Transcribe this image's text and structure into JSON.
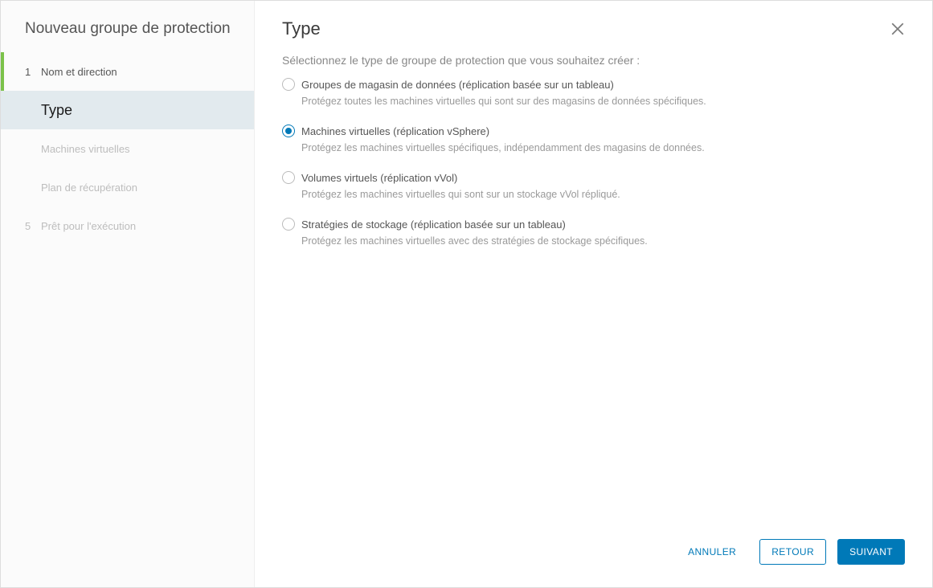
{
  "wizard": {
    "title": "Nouveau groupe de protection",
    "steps": [
      {
        "num": "1",
        "label": "Nom et direction",
        "state": "completed"
      },
      {
        "num": "",
        "label": "Type",
        "state": "active"
      },
      {
        "num": "",
        "label": "Machines virtuelles",
        "state": "pending"
      },
      {
        "num": "",
        "label": "Plan de récupération",
        "state": "pending"
      },
      {
        "num": "5",
        "label": "Prêt pour l'exécution",
        "state": "pending"
      }
    ]
  },
  "page": {
    "title": "Type",
    "instruction": "Sélectionnez le type de groupe de protection que vous souhaitez créer :",
    "options": [
      {
        "id": "datastore-groups",
        "label": "Groupes de magasin de données (réplication basée sur un tableau)",
        "desc": "Protégez toutes les machines virtuelles qui sont sur des magasins de données spécifiques.",
        "checked": false
      },
      {
        "id": "virtual-machines",
        "label": "Machines virtuelles (réplication vSphere)",
        "desc": "Protégez les machines virtuelles spécifiques, indépendamment des magasins de données.",
        "checked": true
      },
      {
        "id": "virtual-volumes",
        "label": "Volumes virtuels (réplication vVol)",
        "desc": "Protégez les machines virtuelles qui sont sur un stockage vVol répliqué.",
        "checked": false
      },
      {
        "id": "storage-policies",
        "label": "Stratégies de stockage (réplication basée sur un tableau)",
        "desc": "Protégez les machines virtuelles avec des stratégies de stockage spécifiques.",
        "checked": false
      }
    ]
  },
  "footer": {
    "cancel": "ANNULER",
    "back": "RETOUR",
    "next": "SUIVANT"
  }
}
